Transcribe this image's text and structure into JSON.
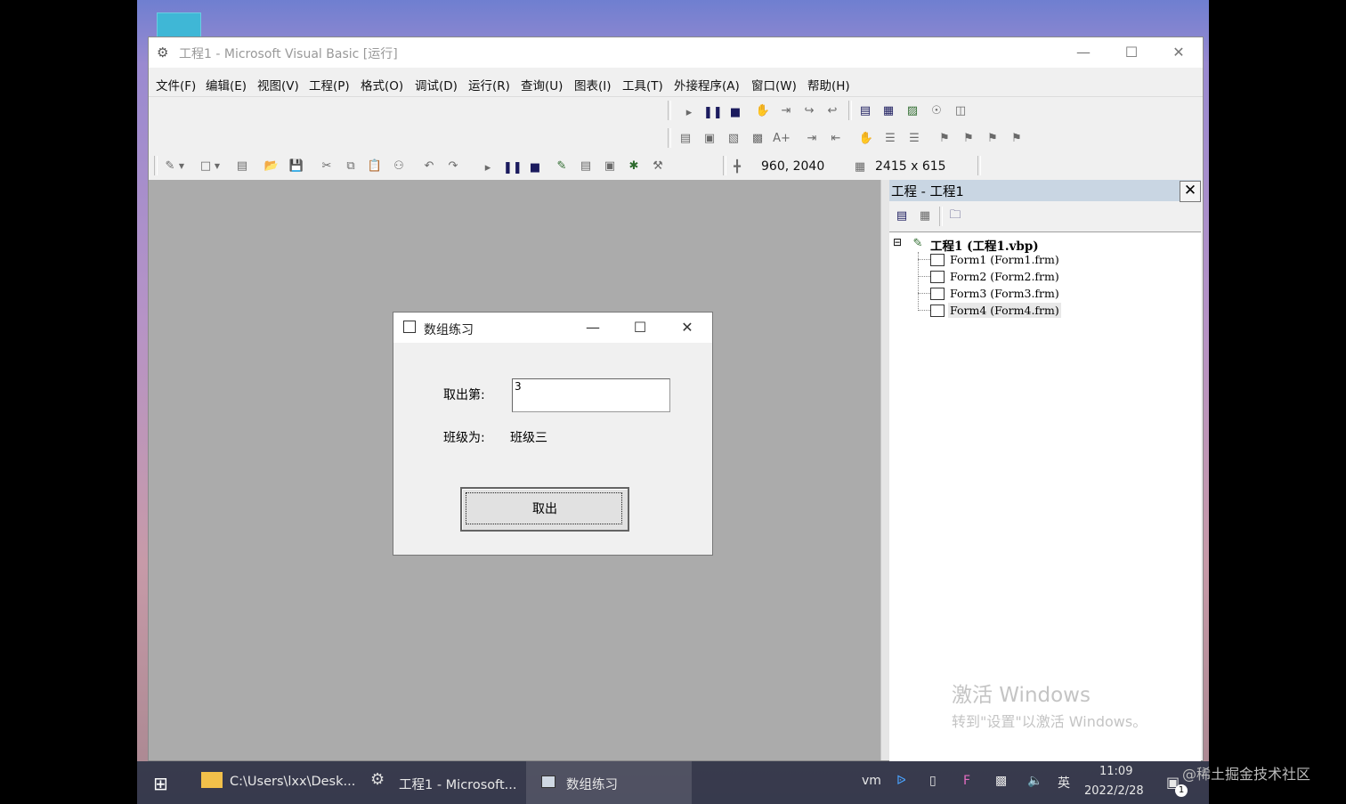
{
  "window": {
    "title": "工程1 - Microsoft Visual Basic [运行]",
    "controls": {
      "minimize": "—",
      "maximize": "☐",
      "close": "✕"
    }
  },
  "menu": [
    "文件(F)",
    "编辑(E)",
    "视图(V)",
    "工程(P)",
    "格式(O)",
    "调试(D)",
    "运行(R)",
    "查询(U)",
    "图表(I)",
    "工具(T)",
    "外接程序(A)",
    "窗口(W)",
    "帮助(H)"
  ],
  "toolbar": {
    "position": "960, 2040",
    "size": "2415 x 615"
  },
  "project_explorer": {
    "title": "工程 - 工程1",
    "close": "✕",
    "root": "工程1 (工程1.vbp)",
    "forms": [
      "Form1 (Form1.frm)",
      "Form2 (Form2.frm)",
      "Form3 (Form3.frm)",
      "Form4 (Form4.frm)"
    ],
    "collapse_glyph": "⊟"
  },
  "activation": {
    "line1": "激活 Windows",
    "line2": "转到\"设置\"以激活 Windows。"
  },
  "form": {
    "title": "数组练习",
    "controls": {
      "minimize": "—",
      "maximize": "☐",
      "close": "✕"
    },
    "label_take": "取出第:",
    "input_value": "3",
    "label_class": "班级为:",
    "class_value": "班级三",
    "button": "取出"
  },
  "taskbar": {
    "items": [
      "C:\\Users\\lxx\\Desk...",
      "工程1 - Microsoft...",
      "数组练习"
    ],
    "ime": "英",
    "time": "11:09",
    "date": "2022/2/28",
    "notification_count": "1"
  },
  "watermark": "@稀土掘金技术社区",
  "colors": {
    "titlebar": "#ffffff",
    "mdi_background": "#ababab",
    "panel_title": "#c9d6e3",
    "taskbar": "#1e2a3e"
  }
}
